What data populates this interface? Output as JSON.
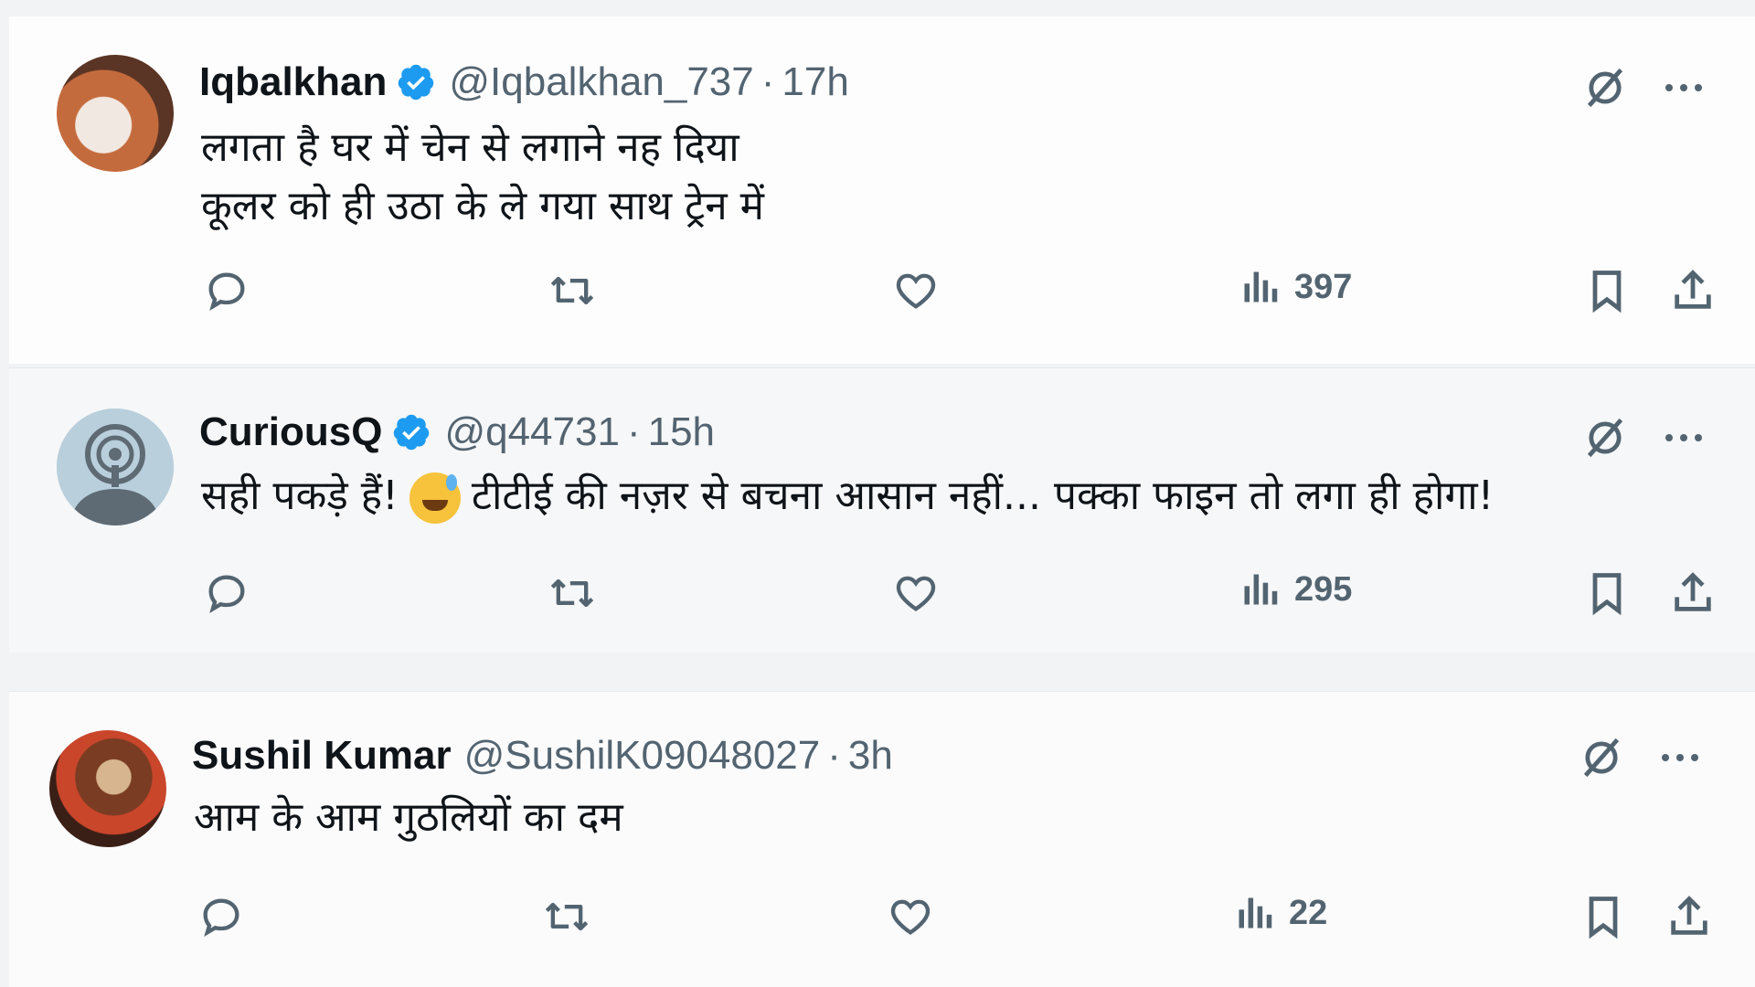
{
  "tweets": [
    {
      "name": "Iqbalkhan",
      "verified": true,
      "handle": "@Iqbalkhan_737",
      "separator": "·",
      "time": "17h",
      "lines": [
        "लगता है घर में चेन से लगाने नह दिया",
        "कूलर को ही उठा के ले गया साथ ट्रेन में"
      ],
      "views": "397"
    },
    {
      "name": "CuriousQ",
      "verified": true,
      "handle": "@q44731",
      "separator": "·",
      "time": "15h",
      "text_before_emoji": "सही पकड़े हैं!",
      "emoji": "grinning-face-with-sweat",
      "text_after_emoji": "टीटीई की नज़र से बचना आसान नहीं... पक्का फाइन तो लगा ही होगा!",
      "views": "295"
    },
    {
      "name": "Sushil Kumar",
      "verified": false,
      "handle": "@SushilK09048027",
      "separator": "·",
      "time": "3h",
      "lines": [
        "आम के आम गुठलियों का दम"
      ],
      "views": "22"
    }
  ],
  "icons": {
    "grok": "grok-icon",
    "more": "more-icon",
    "reply": "reply-icon",
    "retweet": "retweet-icon",
    "like": "like-icon",
    "views": "views-icon",
    "bookmark": "bookmark-icon",
    "share": "share-icon"
  },
  "colors": {
    "verified": "#1d9bf0",
    "text": "#0f1419",
    "muted": "#536471"
  }
}
